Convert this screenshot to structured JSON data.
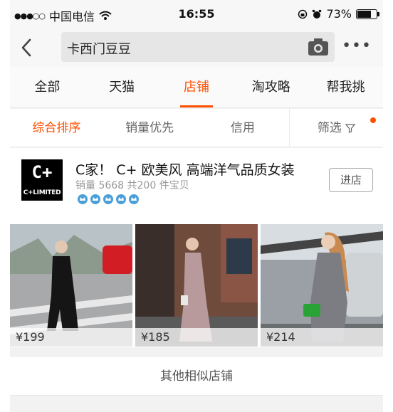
{
  "status_bar": {
    "signal": "●●●○○",
    "carrier": "中国电信",
    "time": "16:55",
    "battery": "73%",
    "battery_level": 0.73
  },
  "search": {
    "back_icon": "chevron-left-icon",
    "query": "卡西门豆豆",
    "camera_icon": "camera-icon",
    "more_icon": "more-icon",
    "more_label": "•••"
  },
  "tabs": [
    {
      "label": "全部",
      "active": false
    },
    {
      "label": "天猫",
      "active": false
    },
    {
      "label": "店铺",
      "active": true
    },
    {
      "label": "淘攻略",
      "active": false
    },
    {
      "label": "帮我挑",
      "active": false
    }
  ],
  "sort": [
    {
      "label": "综合排序",
      "active": true
    },
    {
      "label": "销量优先",
      "active": false
    },
    {
      "label": "信用",
      "active": false
    },
    {
      "label": "筛选",
      "active": false
    }
  ],
  "shop": {
    "logo_big": "C+",
    "logo_small": "C+LIMITED",
    "name": "C家！ C+ 欧美风 高端洋气品质女装",
    "meta": "销量 5668  共200 件宝贝",
    "badge_count": 5,
    "enter_label": "进店",
    "products": [
      {
        "price": "¥199"
      },
      {
        "price": "¥185"
      },
      {
        "price": "¥214"
      }
    ]
  },
  "similar_label": "其他相似店铺",
  "colors": {
    "accent": "#ff5000",
    "badge": "#4a9fd8"
  }
}
